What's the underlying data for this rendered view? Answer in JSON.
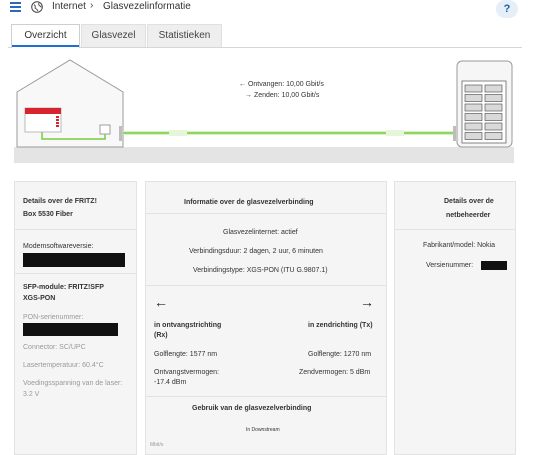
{
  "breadcrumb": {
    "root": "Internet",
    "separator": "›",
    "current": "Glasvezelinformatie"
  },
  "help_label": "?",
  "tabs": [
    {
      "label": "Overzicht",
      "active": true
    },
    {
      "label": "Glasvezel",
      "active": false
    },
    {
      "label": "Statistieken",
      "active": false
    }
  ],
  "connection": {
    "receive": "← Ontvangen: 10,00 Gbit/s",
    "send": "→ Zenden: 10,00 Gbit/s"
  },
  "fritz": {
    "title_line1": "Details over de FRITZ!",
    "title_line2": "Box 5530 Fiber",
    "modem_label": "Modemsoftwareversie:",
    "sfp_line1": "SFP-module: FRITZ!SFP",
    "sfp_line2": "XGS-PON",
    "pon_serial": "PON-serienummer:",
    "connector": "Connector: SC/UPC",
    "laser_temp": "Lasertemperatuur: 60.4°C",
    "voltage_line1": "Voedingsspanning van de laser:",
    "voltage_line2": "3.2 V"
  },
  "info": {
    "title": "Informatie over de glasvezelverbinding",
    "internet": "Glasvezelinternet: actief",
    "duration": "Verbindingsduur: 2 dagen, 2 uur, 6 minuten",
    "type": "Verbindingstype: XGS-PON (ITU G.9807.1)",
    "rx_arrow": "←",
    "tx_arrow": "→",
    "rx_title_line1": "in ontvangstrichting",
    "rx_title_line2": "(Rx)",
    "tx_title": "in zendrichting (Tx)",
    "rx_wavelength": "Golflengte: 1577 nm",
    "tx_wavelength": "Golflengte: 1270 nm",
    "rx_power_line1": "Ontvangstvermogen:",
    "rx_power_line2": "-17.4 dBm",
    "tx_power": "Zendvermogen: 5 dBm",
    "usage_title": "Gebruik van de glasvezelverbinding",
    "downstream": "In Downstream",
    "axis_unit": "Mbit/s"
  },
  "operator": {
    "title_line1": "Details over de",
    "title_line2": "netbeheerder",
    "manufacturer": "Fabrikant/model: Nokia",
    "version": "Versienummer:"
  },
  "colors": {
    "accent": "#1e6fd0",
    "fiber_green": "#7acc3a",
    "fritz_red": "#d8242f"
  }
}
